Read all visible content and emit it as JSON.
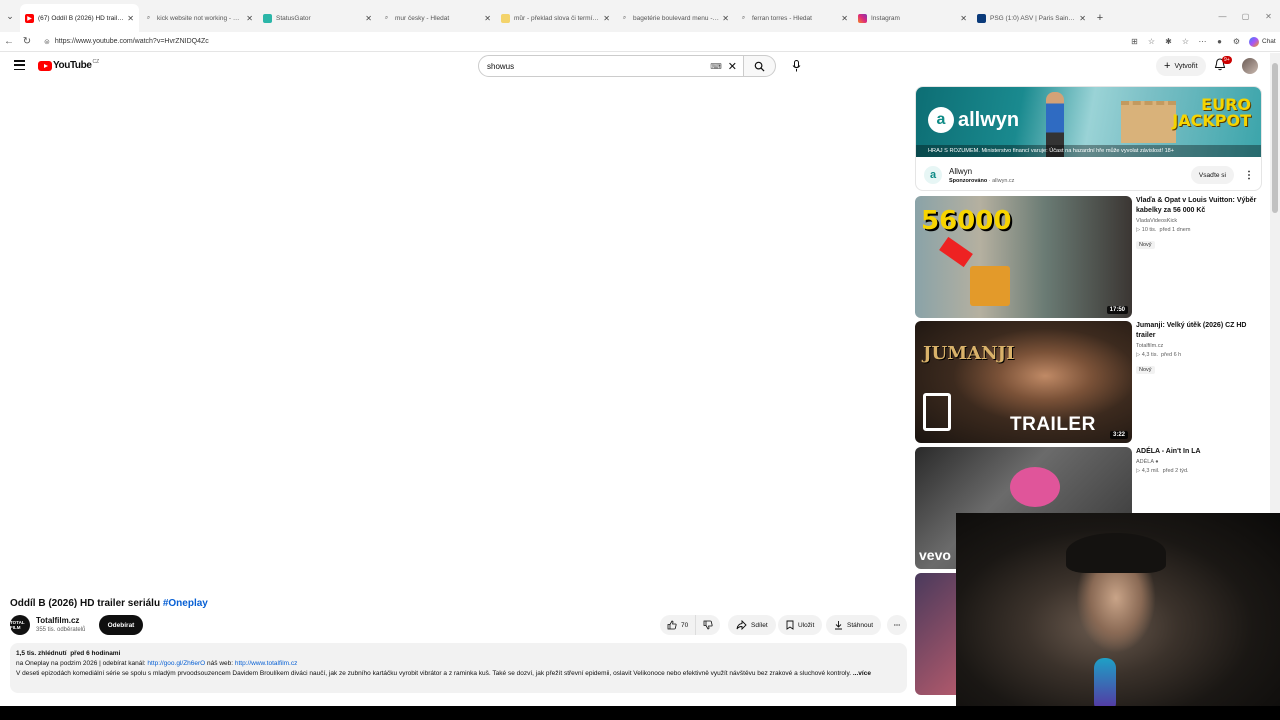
{
  "browser": {
    "tabs": [
      {
        "title": "(67) Oddíl B (2026) HD trailer seriá",
        "fav": "yt",
        "active": true
      },
      {
        "title": "kick website not working - Hledat",
        "fav": "search",
        "active": false
      },
      {
        "title": "StatusGator",
        "fav": "sg",
        "active": false
      },
      {
        "title": "mur česky - Hledat",
        "fav": "search",
        "active": false
      },
      {
        "title": "můr - překlad slova či termínu a p",
        "fav": "dict",
        "active": false
      },
      {
        "title": "bagetérie boulevard menu - Hleda",
        "fav": "search",
        "active": false
      },
      {
        "title": "ferran torres - Hledat",
        "fav": "search",
        "active": false
      },
      {
        "title": "Instagram",
        "fav": "ig",
        "active": false
      },
      {
        "title": "PSG (1:0) ASV | Paris Saint-Germai",
        "fav": "psg",
        "active": false
      }
    ],
    "url": "https://www.youtube.com/watch?v=HvrZNIDQ4Zc",
    "chat_label": "Chat"
  },
  "youtube": {
    "logo_text": "YouTube",
    "logo_country": "CZ",
    "search_value": "showus",
    "create_label": "Vytvořit",
    "notif_count": "9+"
  },
  "video": {
    "title": "Oddíl B (2026) HD trailer seriálu",
    "hashtag": "#Oneplay",
    "channel": "Totalfilm.cz",
    "channel_avatar_text": "TOTAL FILM",
    "subscribers": "355 tis. odběratelů",
    "subscribe_label": "Odebírat",
    "likes": "70",
    "share_label": "Sdílet",
    "save_label": "Uložit",
    "download_label": "Stáhnout",
    "views": "1,5 tis. zhlédnutí",
    "posted": "před 6 hodinami",
    "desc_line1_pre": "na Oneplay na podzim 2026 | odebírat kanál: ",
    "desc_link1": "http://goo.gl/Zh6erO",
    "desc_line1_mid": " náš web: ",
    "desc_link2": "http://www.totalfilm.cz",
    "desc_line2": "V deseti epizodách komediální série se spolu s mladým prvoodsouzencem Davidem Broulíkem diváci naučí, jak ze zubního kartáčku vyrobit vibrátor a z raminka kuš. Také se dozví, jak přežít střevní epidemii, oslavit Velikonoce nebo efektivně využít návštěvu bez zrakové a sluchové kontroly.",
    "more_label": "...více"
  },
  "ad": {
    "brand_logo": "allwyn",
    "jackpot_line1": "EURO",
    "jackpot_line2": "JACKPOT",
    "disclaimer": "HRAJ S ROZUMEM. Ministerstvo financí varuje: Účast na hazardní hře může vyvolat závislost! 18+",
    "advertiser": "Allwyn",
    "sponsored": "Sponzorováno",
    "domain": "allwyn.cz",
    "cta": "Vsaďte si"
  },
  "recommendations": [
    {
      "title": "Vlaďa & Opat v Louis Vuitton: Výběr kabelky za 56 000 Kč",
      "channel": "VladaVideosKick",
      "views": "10 tis.",
      "age": "před 1 dnem",
      "badge": "Nový",
      "duration": "17:50",
      "thumb_text": "56000"
    },
    {
      "title": "Jumanji: Velký útěk (2026) CZ HD trailer",
      "channel": "Totalfilm.cz",
      "views": "4,3 tis.",
      "age": "před 6 h",
      "badge": "Nový",
      "duration": "3:22",
      "thumb_text": "TRAILER",
      "thumb_text2": "JUMANJI"
    },
    {
      "title": "ADÉLA - Ain't In LA",
      "channel": "ADÉLA",
      "views": "4,3 mil.",
      "age": "před 2 týd.",
      "badge": "",
      "duration": "",
      "thumb_text": "vevo"
    }
  ]
}
